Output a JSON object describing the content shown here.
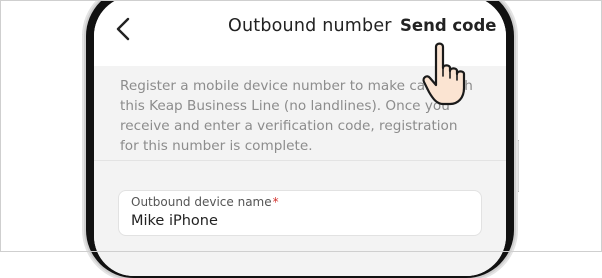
{
  "header": {
    "back_icon": "chevron-left-icon",
    "title": "Outbound number",
    "send_code_label": "Send code"
  },
  "info": {
    "text": "Register a mobile device number to make calls with this Keap Business Line (no landlines). Once you receive and enter a verification code, registration for this number is complete."
  },
  "form": {
    "outbound_device_name": {
      "label": "Outbound device name",
      "required_mark": "*",
      "value": "Mike iPhone"
    }
  },
  "overlay": {
    "pointer_icon": "hand-pointer-icon"
  }
}
